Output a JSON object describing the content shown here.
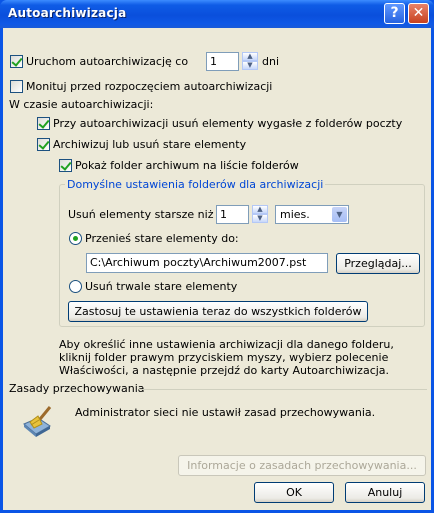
{
  "window": {
    "title": "Autoarchiwizacja",
    "help_label": "?",
    "close_label": "✕"
  },
  "run_every": {
    "label_before": "Uruchom autoarchiwizację co",
    "value": "1",
    "label_after": "dni",
    "checked": true
  },
  "prompt_before": {
    "label": "Monituj przed rozpoczęciem autoarchiwizacji",
    "checked": false
  },
  "during_label": "W czasie autoarchiwizacji:",
  "delete_expired": {
    "label": "Przy autoarchiwizacji usuń elementy wygasłe z folderów poczty",
    "checked": true
  },
  "archive_or_delete": {
    "label": "Archiwizuj lub usuń stare elementy",
    "checked": true
  },
  "show_archive_folder": {
    "label": "Pokaż folder archiwum na liście folderów",
    "checked": true
  },
  "default_folder_settings": {
    "legend": "Domyślne ustawienia folderów dla archiwizacji",
    "older_than_label": "Usuń elementy starsze niż",
    "older_than_value": "1",
    "unit_value": "mies.",
    "move_old": {
      "label": "Przenieś stare elementy do:",
      "selected": true
    },
    "path_value": "C:\\Archiwum poczty\\Archiwum2007.pst",
    "browse_label": "Przeglądaj...",
    "delete_permanently": {
      "label": "Usuń trwale stare elementy",
      "selected": false
    },
    "apply_all_label": "Zastosuj te ustawienia teraz do wszystkich folderów"
  },
  "info_text": [
    "Aby określić inne ustawienia archiwizacji dla danego folderu,",
    "kliknij folder prawym przyciskiem myszy, wybierz polecenie",
    "Właściwości, a następnie przejdź do karty Autoarchiwizacja."
  ],
  "retention": {
    "legend": "Zasady przechowywania",
    "message": "Administrator sieci nie ustawił zasad przechowywania.",
    "info_button": "Informacje o zasadach przechowywania...",
    "icon": "broom-icon"
  },
  "buttons": {
    "ok": "OK",
    "cancel": "Anuluj"
  }
}
